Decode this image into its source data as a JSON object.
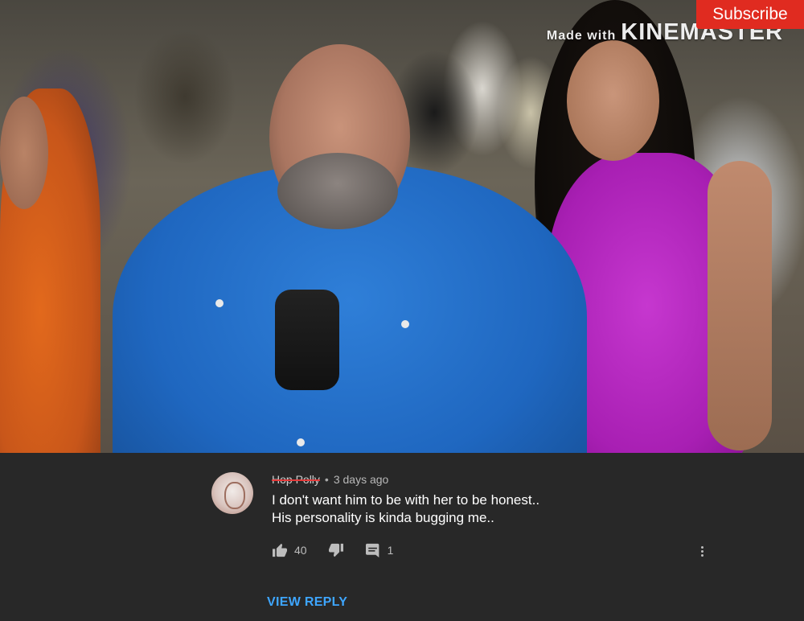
{
  "video": {
    "watermark_prefix": "Made with",
    "watermark_brand": "KINEMASTER",
    "subscribe_label": "Subscribe"
  },
  "comment": {
    "author": "Hop Polly",
    "time_ago": "3 days ago",
    "text_line1": "I don't want him to be with her to be honest..",
    "text_line2": "His personality is kinda bugging me..",
    "like_count": "40",
    "reply_count": "1"
  },
  "view_reply_label": "VIEW REPLY",
  "colors": {
    "background": "#282828",
    "link_blue": "#3ea6ff",
    "subscribe_red": "#e02b20",
    "strikethrough_red": "#e53a3a"
  },
  "icons": [
    "thumbs-up-icon",
    "thumbs-down-icon",
    "comment-reply-icon",
    "more-vert-icon"
  ]
}
